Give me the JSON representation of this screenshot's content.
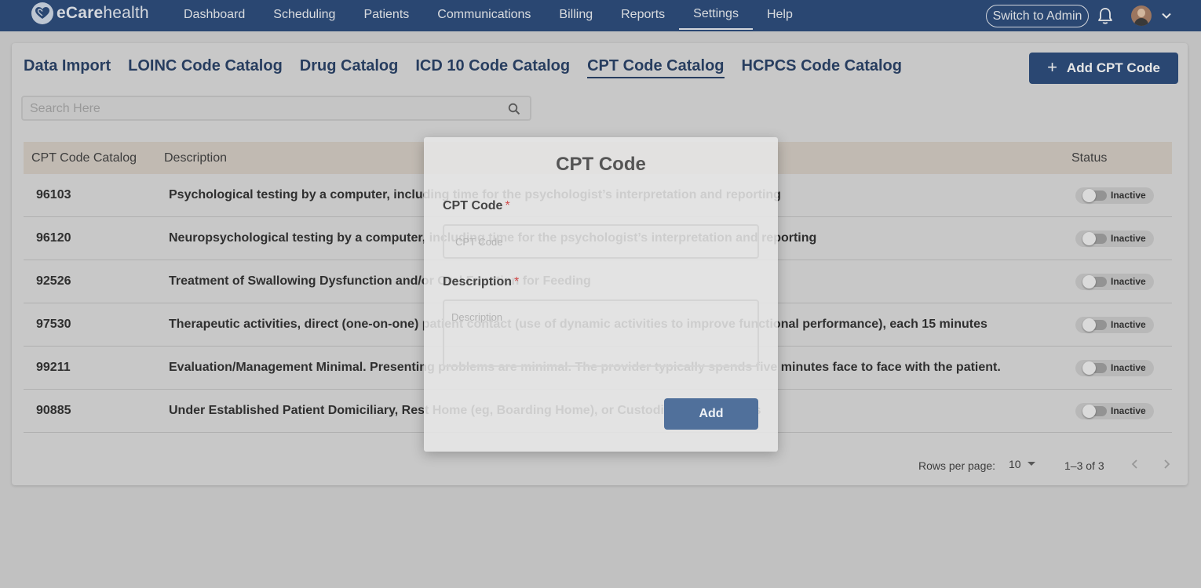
{
  "brand": {
    "prefix": "eCare",
    "suffix": "health"
  },
  "nav": {
    "items": [
      "Dashboard",
      "Scheduling",
      "Patients",
      "Communications",
      "Billing",
      "Reports",
      "Settings",
      "Help"
    ],
    "active": "Settings",
    "switch_label": "Switch to Admin"
  },
  "catalog_tabs": {
    "items": [
      "Data Import",
      "LOINC Code Catalog",
      "Drug Catalog",
      "ICD 10 Code Catalog",
      "CPT Code Catalog",
      "HCPCS Code Catalog"
    ],
    "active": "CPT Code Catalog"
  },
  "add_button_label": "Add CPT Code",
  "search": {
    "placeholder": "Search Here",
    "value": ""
  },
  "table": {
    "columns": [
      "CPT Code Catalog",
      "Description",
      "Status"
    ],
    "rows": [
      {
        "code": "96103",
        "description": "Psychological testing by a computer, including time for the psychologist’s interpretation and reporting",
        "status": "Inactive"
      },
      {
        "code": "96120",
        "description": "Neuropsychological testing by a computer, including time for the psychologist’s interpretation and reporting",
        "status": "Inactive"
      },
      {
        "code": "92526",
        "description": "Treatment of Swallowing Dysfunction and/or Oral Function for Feeding",
        "status": "Inactive"
      },
      {
        "code": "97530",
        "description": "Therapeutic activities, direct (one-on-one) patient contact (use of dynamic activities to improve functional performance), each 15 minutes",
        "status": "Inactive"
      },
      {
        "code": "99211",
        "description": "Evaluation/Management Minimal. Presenting problems are minimal. The provider typically spends five minutes face to face with the patient.",
        "status": "Inactive"
      },
      {
        "code": "90885",
        "description": "Under Established Patient Domiciliary, Rest Home (eg, Boarding Home), or Custodial Care Services",
        "status": "Inactive"
      }
    ]
  },
  "pagination": {
    "rows_per_page_label": "Rows per page:",
    "rows_per_page": "10",
    "range": "1–3 of 3"
  },
  "dialog": {
    "title": "CPT Code",
    "code_label": "CPT Code",
    "code_placeholder": "CPT Code",
    "code_value": "",
    "description_label": "Description",
    "description_placeholder": "Description",
    "description_value": "",
    "required_mark": "*",
    "submit_label": "Add"
  },
  "colors": {
    "topbar": "#1b3f73",
    "primary_button": "#1b3f73",
    "table_header": "#d4cbc1",
    "required": "#d24c4c",
    "dialog_button": "#50709b"
  },
  "icons": [
    "heart-logo-icon",
    "bell-icon",
    "chevron-down-icon",
    "plus-icon",
    "search-icon",
    "caret-down-icon",
    "chevron-left-icon",
    "chevron-right-icon"
  ]
}
